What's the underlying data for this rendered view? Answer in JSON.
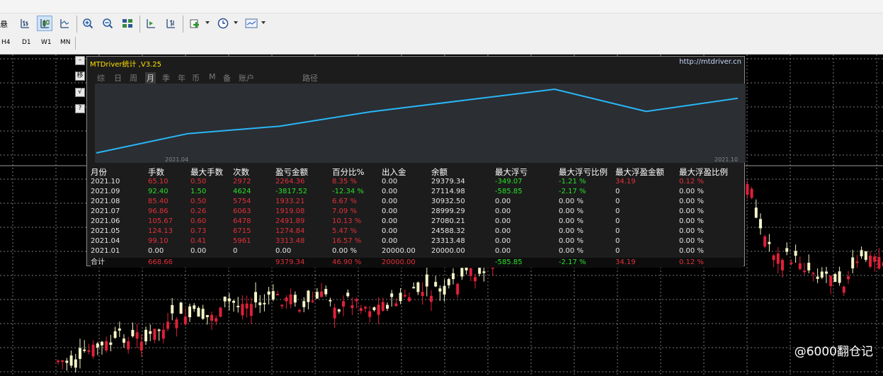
{
  "toolbar": {
    "timeframes": [
      "H4",
      "D1",
      "W1",
      "MN"
    ],
    "left_edge_label": "悬"
  },
  "side_buttons": [
    "移",
    "√",
    "?"
  ],
  "panel": {
    "title": "MTDriver统计 ,V3.25",
    "url": "http://mtdriver.cn",
    "tabs": [
      "综",
      "日",
      "周",
      "月",
      "季",
      "年",
      "币",
      "M",
      "备",
      "账户",
      "路径"
    ],
    "selected_tab": "月",
    "mini_chart": {
      "x_start_label": "2021.04",
      "x_end_label": "2021.10",
      "line_color": "#29b6f6"
    },
    "table": {
      "headers": [
        "月份",
        "手数",
        "最大手数",
        "次数",
        "盈亏金额",
        "百分比%",
        "出入金",
        "余额",
        "最大浮亏",
        "最大浮亏比例",
        "最大浮盈金额",
        "最大浮盈比例"
      ],
      "rows": [
        [
          "2021.10",
          "65.10",
          "0.50",
          "2972",
          "2264.36",
          "8.35 %",
          "0.00",
          "29379.34",
          "-349.07",
          "-1.21 %",
          "34.19",
          "0.12 %"
        ],
        [
          "2021.09",
          "92.40",
          "1.50",
          "4624",
          "-3817.52",
          "-12.34 %",
          "0.00",
          "27114.98",
          "-585.85",
          "-2.17 %",
          "0",
          "0.00 %"
        ],
        [
          "2021.08",
          "85.40",
          "0.50",
          "5754",
          "1933.21",
          "6.67 %",
          "0.00",
          "30932.50",
          "0.00",
          "0.00 %",
          "0",
          "0.00 %"
        ],
        [
          "2021.07",
          "96.86",
          "0.26",
          "6063",
          "1919.08",
          "7.09 %",
          "0.00",
          "28999.29",
          "0.00",
          "0.00 %",
          "0",
          "0.00 %"
        ],
        [
          "2021.06",
          "105.67",
          "0.60",
          "6478",
          "2491.89",
          "10.13 %",
          "0.00",
          "27080.21",
          "0.00",
          "0.00 %",
          "0",
          "0.00 %"
        ],
        [
          "2021.05",
          "124.13",
          "0.73",
          "6715",
          "1274.84",
          "5.47 %",
          "0.00",
          "24588.32",
          "0.00",
          "0.00 %",
          "0",
          "0.00 %"
        ],
        [
          "2021.04",
          "99.10",
          "0.41",
          "5961",
          "3313.48",
          "16.57 %",
          "0.00",
          "23313.48",
          "0.00",
          "0.00 %",
          "0",
          "0.00 %"
        ],
        [
          "2021.01",
          "0.00",
          "0.00",
          "0",
          "0.00",
          "0.00 %",
          "20000.00",
          "20000.00",
          "0.00",
          "0.00 %",
          "0",
          "0.00 %"
        ]
      ],
      "row_colors": [
        "red",
        "green",
        "red",
        "red",
        "red",
        "red",
        "red",
        "white"
      ],
      "total": [
        "合计",
        "668.66",
        "",
        "",
        "9379.34",
        "46.90 %",
        "20000.00",
        "",
        "-585.85",
        "-2.17 %",
        "34.19",
        "0.12 %"
      ]
    }
  },
  "watermark": "@6000翻仓记",
  "colors": {
    "profit": "#e0303a",
    "loss": "#28e028",
    "neutral": "#e6e6e6",
    "bull_candle": "#f5f5c8",
    "bear_candle": "#e0203a"
  }
}
